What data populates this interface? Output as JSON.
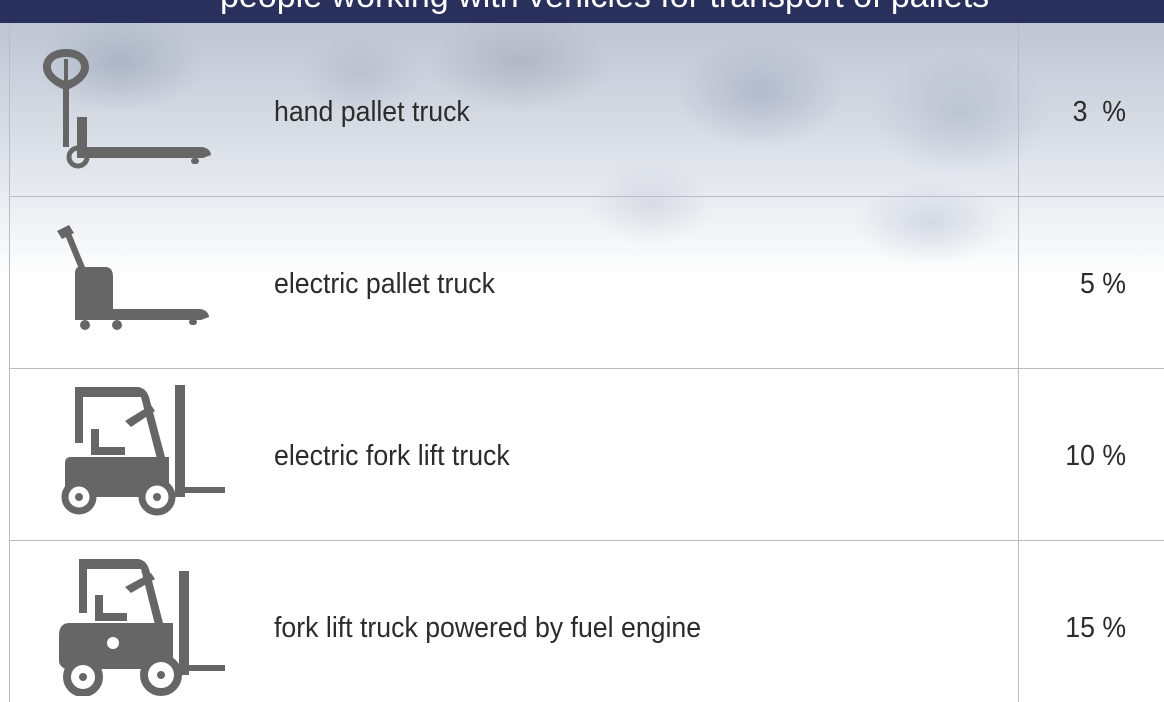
{
  "header": {
    "text": "people working with vehicles for transport of pallets"
  },
  "rows": [
    {
      "label": "hand pallet truck",
      "value": "3  %",
      "icon": "hand-pallet-truck-icon"
    },
    {
      "label": "electric pallet truck",
      "value": "5 %",
      "icon": "electric-pallet-truck-icon"
    },
    {
      "label": "electric fork lift truck",
      "value": "10 %",
      "icon": "electric-fork-lift-truck-icon"
    },
    {
      "label": "fork lift truck powered by fuel engine",
      "value": "15 %",
      "icon": "fuel-fork-lift-truck-icon"
    }
  ],
  "colors": {
    "header_bg": "#28305b",
    "icon_fill": "#666666",
    "text": "#2c2c2c",
    "grid": "#b9bcc4"
  }
}
